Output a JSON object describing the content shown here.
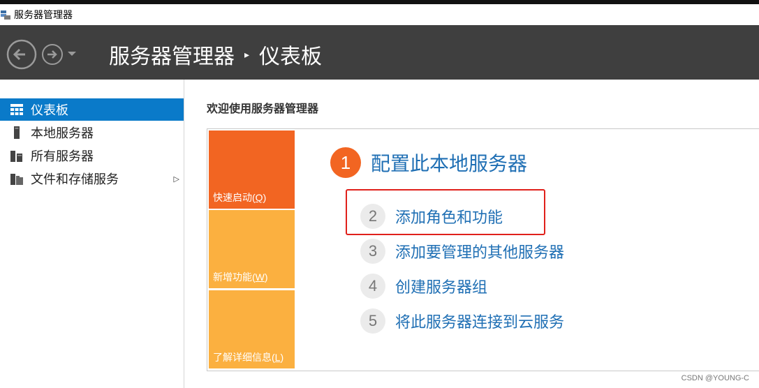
{
  "window": {
    "title": "服务器管理器",
    "app_icon": "server-manager-icon"
  },
  "header": {
    "app_name": "服务器管理器",
    "separator": "▸",
    "page": "仪表板",
    "back_icon": "back-arrow-icon",
    "forward_icon": "forward-arrow-icon",
    "dropdown_icon": "chevron-down-icon"
  },
  "sidebar": {
    "items": [
      {
        "label": "仪表板",
        "icon": "dashboard-icon",
        "active": true
      },
      {
        "label": "本地服务器",
        "icon": "local-server-icon",
        "active": false
      },
      {
        "label": "所有服务器",
        "icon": "all-servers-icon",
        "active": false
      },
      {
        "label": "文件和存储服务",
        "icon": "file-storage-icon",
        "active": false,
        "has_submenu": true
      }
    ]
  },
  "main": {
    "welcome_title": "欢迎使用服务器管理器",
    "tiles": [
      {
        "label": "快速启动(",
        "key": "Q",
        "suffix": ")",
        "color": "#f26522"
      },
      {
        "label": "新增功能(",
        "key": "W",
        "suffix": ")",
        "color": "#fbb040"
      },
      {
        "label": "了解详细信息(",
        "key": "L",
        "suffix": ")",
        "color": "#fbb040"
      }
    ],
    "steps": [
      {
        "number": "1",
        "label": "配置此本地服务器"
      },
      {
        "number": "2",
        "label": "添加角色和功能"
      },
      {
        "number": "3",
        "label": "添加要管理的其他服务器"
      },
      {
        "number": "4",
        "label": "创建服务器组"
      },
      {
        "number": "5",
        "label": "将此服务器连接到云服务"
      }
    ]
  },
  "watermark": "CSDN @YOUNG-C",
  "colors": {
    "header_bg": "#3f3f3f",
    "accent_blue": "#0a7ac9",
    "link_blue": "#1f6fb4",
    "orange": "#f26522",
    "light_orange": "#fbb040",
    "highlight_red": "#e0201b"
  }
}
